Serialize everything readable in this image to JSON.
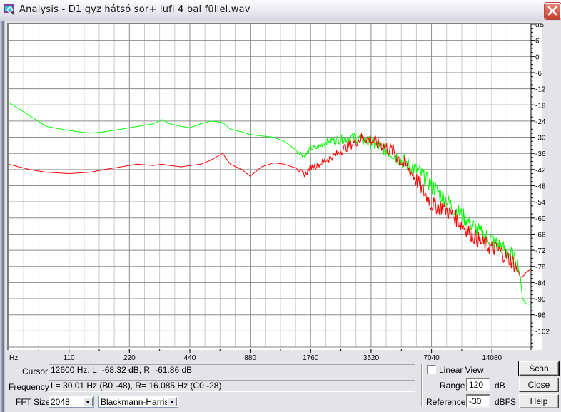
{
  "window": {
    "title": "Analysis - D1 gyz hátsó sor+ lufi 4 bal füllel.wav",
    "close_icon": "close-x-icon",
    "app_icon": "analysis-magnifier-icon"
  },
  "chart_data": {
    "type": "line",
    "title": "",
    "xlabel": "Hz",
    "ylabel": "dB",
    "xscale": "log",
    "xlim": [
      55,
      22050
    ],
    "ylim": [
      -108,
      12
    ],
    "x_ticks": [
      "Hz",
      "110",
      "220",
      "440",
      "880",
      "1760",
      "3520",
      "7040",
      "14080"
    ],
    "x_tick_values": [
      55,
      110,
      220,
      440,
      880,
      1760,
      3520,
      7040,
      14080
    ],
    "y_ticks": [
      "dB",
      "6",
      "0",
      "-6",
      "-12",
      "-18",
      "-24",
      "-30",
      "-36",
      "-42",
      "-48",
      "-54",
      "-60",
      "-66",
      "-72",
      "-78",
      "-84",
      "-90",
      "-96",
      "-102"
    ],
    "y_tick_values": [
      12,
      6,
      0,
      -6,
      -12,
      -18,
      -24,
      -30,
      -36,
      -42,
      -48,
      -54,
      -60,
      -66,
      -72,
      -78,
      -84,
      -90,
      -96,
      -102
    ],
    "grid": true,
    "legend": "none",
    "series": [
      {
        "name": "L (green)",
        "color": "#00ff00",
        "x": [
          55,
          70,
          85,
          110,
          140,
          165,
          200,
          240,
          290,
          320,
          350,
          400,
          440,
          500,
          560,
          640,
          700,
          800,
          880,
          1000,
          1150,
          1300,
          1500,
          1650,
          1760,
          1900,
          2100,
          2350,
          2600,
          2900,
          3200,
          3520,
          4000,
          4500,
          5000,
          5600,
          6300,
          7040,
          8000,
          9000,
          10000,
          11200,
          12600,
          14080,
          15800,
          17700,
          18900,
          19500,
          20000,
          21000,
          22050
        ],
        "values": [
          -17,
          -22,
          -26,
          -27.5,
          -28.5,
          -28,
          -27,
          -26,
          -25,
          -23.5,
          -25,
          -26,
          -26.5,
          -25,
          -24,
          -24.5,
          -27,
          -28,
          -29,
          -29.5,
          -30,
          -31.5,
          -35,
          -37,
          -34,
          -34,
          -31.5,
          -31,
          -30.5,
          -30,
          -31,
          -32,
          -34,
          -36,
          -38.5,
          -41,
          -44,
          -48,
          -52,
          -56,
          -59,
          -62.5,
          -66,
          -68,
          -71,
          -74,
          -77.5,
          -82,
          -90,
          -92,
          -92
        ]
      },
      {
        "name": "R (red)",
        "color": "#ff0000",
        "x": [
          55,
          70,
          85,
          110,
          140,
          165,
          200,
          240,
          290,
          320,
          350,
          400,
          440,
          500,
          560,
          640,
          700,
          800,
          880,
          1000,
          1150,
          1300,
          1500,
          1650,
          1760,
          1900,
          2100,
          2350,
          2600,
          2900,
          3200,
          3520,
          4000,
          4500,
          5000,
          5600,
          6300,
          7040,
          8000,
          9000,
          10000,
          11200,
          12600,
          14080,
          15800,
          17700,
          18900,
          19500,
          20000,
          21000,
          22050
        ],
        "values": [
          -40,
          -42,
          -43,
          -43.5,
          -43,
          -42,
          -41,
          -40,
          -40.5,
          -40,
          -40.5,
          -41,
          -40.5,
          -40,
          -38.5,
          -36,
          -40,
          -42,
          -44.5,
          -41,
          -39.5,
          -40,
          -41.5,
          -44,
          -41,
          -40.5,
          -38.5,
          -36.5,
          -34,
          -32,
          -30,
          -31,
          -33,
          -35,
          -39,
          -43,
          -49,
          -55,
          -56,
          -59,
          -62.5,
          -66,
          -69.5,
          -71,
          -73,
          -76,
          -79,
          -82,
          -82,
          -80,
          -79
        ]
      }
    ]
  },
  "readouts": {
    "cursor_label": "Cursor:",
    "cursor_value": "12600 Hz, L=-68.32 dB, R=-61.86 dB",
    "frequency_label": "Frequency:",
    "frequency_value": "L=  30.01 Hz (B0 -48), R= 16.085 Hz (C0 -28)"
  },
  "fft": {
    "label": "FFT Size:",
    "size_value": "2048",
    "window_value": "Blackmann-Harris"
  },
  "options": {
    "linear_view_label": "Linear View",
    "linear_view_checked": false,
    "range_label": "Range",
    "range_value": "120",
    "range_unit": "dB",
    "reference_label": "Reference",
    "reference_value": "-30",
    "reference_unit": "dBFS"
  },
  "buttons": {
    "scan": "Scan",
    "close": "Close",
    "help": "Help"
  }
}
